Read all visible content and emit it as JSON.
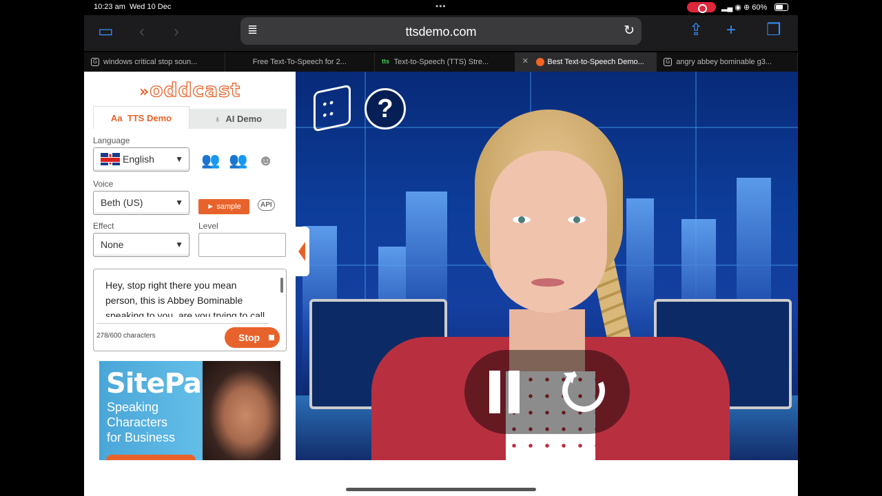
{
  "status": {
    "time": "10:23 am",
    "date": "Wed 10 Dec",
    "battery": "60%"
  },
  "browser": {
    "url": "ttsdemo.com",
    "tabs": [
      {
        "label": "windows critical stop soun...",
        "favicon": "G"
      },
      {
        "label": "Free Text-To-Speech for 2...",
        "favicon": ""
      },
      {
        "label": "Text-to-Speech (TTS) Stre...",
        "favicon": "tts"
      },
      {
        "label": "Best Text-to-Speech Demo...",
        "favicon": "oddcast",
        "active": true
      },
      {
        "label": "angry abbey bominable g3...",
        "favicon": "G"
      }
    ]
  },
  "panel": {
    "logo": "oddcast",
    "tab_tts": "TTS Demo",
    "tab_ai": "AI Demo",
    "language_label": "Language",
    "language_value": "English",
    "voice_label": "Voice",
    "voice_value": "Beth (US)",
    "sample_label": "► sample",
    "api_label": "API",
    "effect_label": "Effect",
    "effect_value": "None",
    "level_label": "Level",
    "level_value": "",
    "text": "Hey, stop right there you mean person, this is Abbey Bominable speaking to you, are you trying to call",
    "char_count": "278/600 characters",
    "stop_label": "Stop"
  },
  "ad": {
    "brand": "SitePal",
    "tagline_1": "Speaking",
    "tagline_2": "Characters",
    "tagline_3": "for Business"
  },
  "icons": {
    "dice": "dice-icon",
    "help": "?",
    "pause": "pause-icon",
    "replay": "replay-icon"
  },
  "colors": {
    "accent": "#e8632b",
    "safari_blue": "#3a8bf7"
  }
}
